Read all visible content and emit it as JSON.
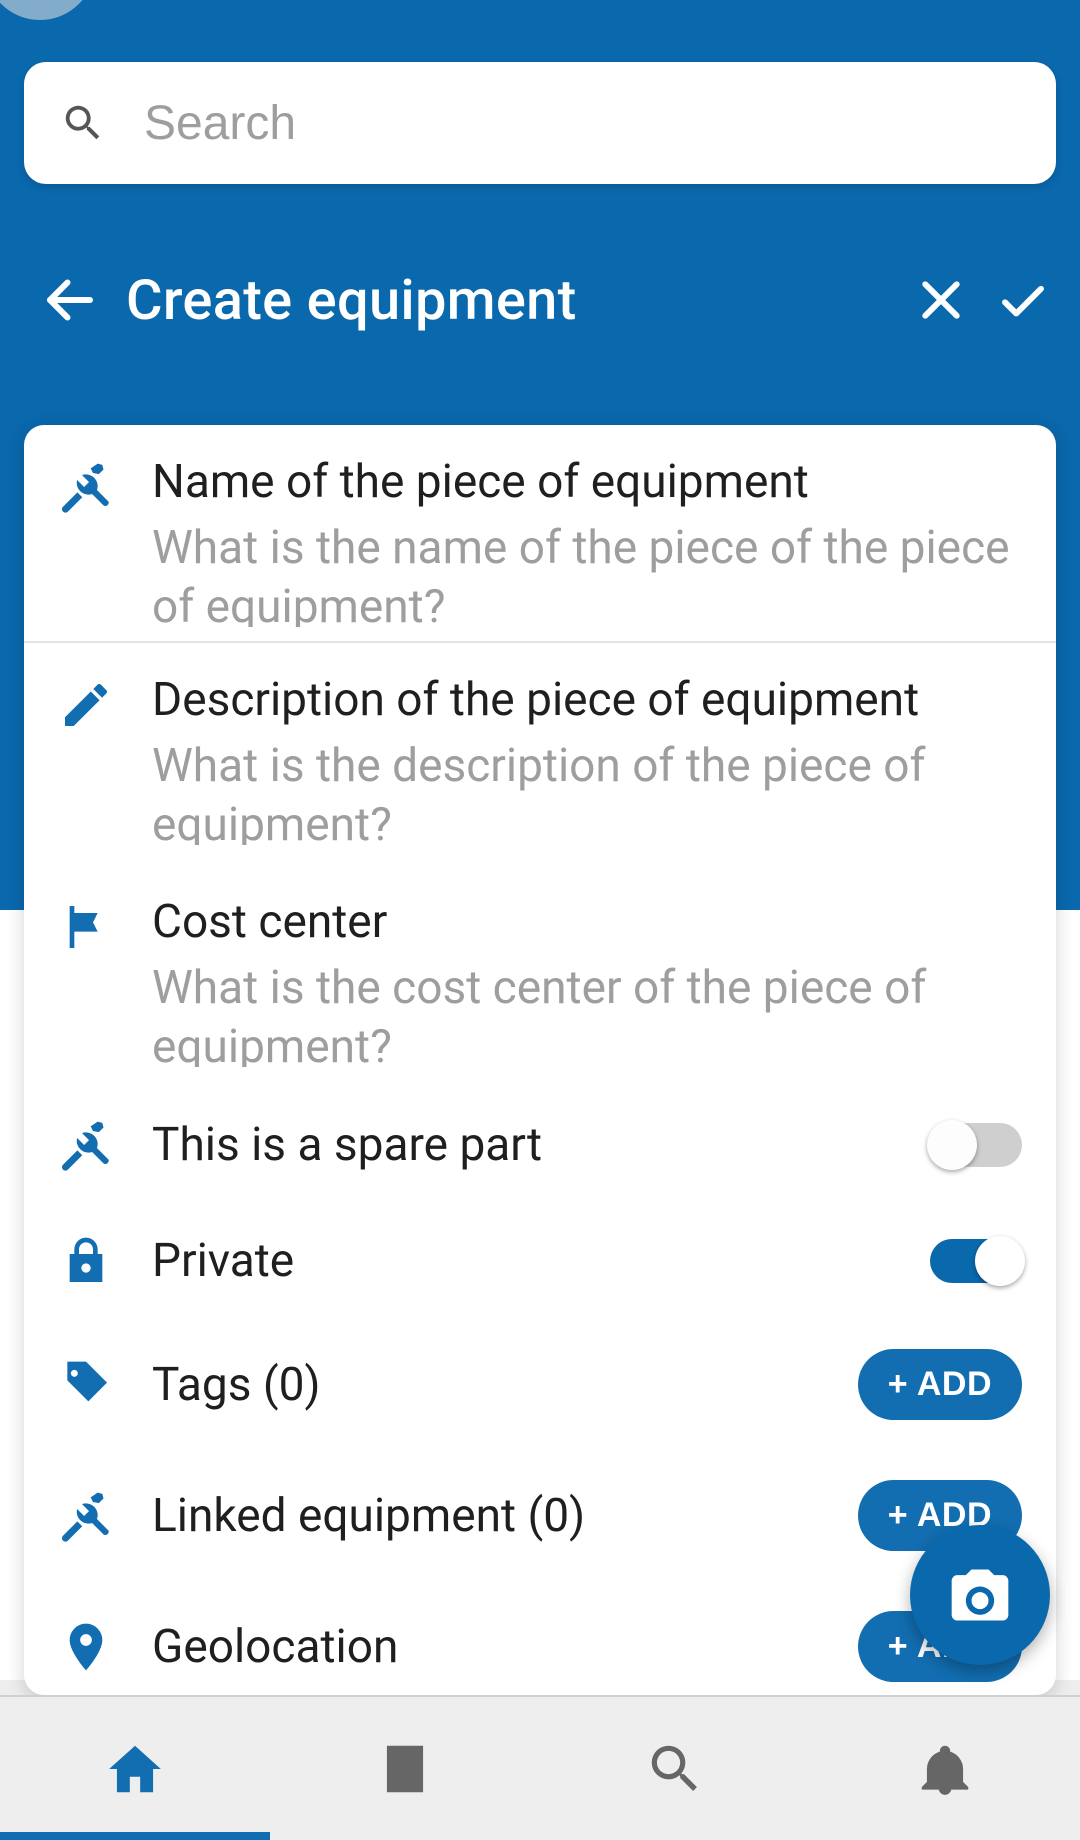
{
  "search": {
    "placeholder": "Search"
  },
  "header": {
    "title": "Create equipment"
  },
  "fields": {
    "name": {
      "label": "Name of the piece of equipment",
      "placeholder": "What is the name of the piece of the piece of equipment?"
    },
    "description": {
      "label": "Description of the piece of equipment",
      "placeholder": "What is the description of the piece of equipment?"
    },
    "cost_center": {
      "label": "Cost center",
      "placeholder": "What is the cost center of the piece of equipment?"
    }
  },
  "toggles": {
    "spare_part": {
      "label": "This is a spare part",
      "value": false
    },
    "private": {
      "label": "Private",
      "value": true
    }
  },
  "lists": {
    "tags": {
      "label": "Tags (0)",
      "count": 0,
      "button": "+ ADD"
    },
    "linked_equipment": {
      "label": "Linked equipment (0)",
      "count": 0,
      "button": "+ ADD"
    },
    "geolocation": {
      "label": "Geolocation",
      "button": "+ ADD"
    }
  },
  "colors": {
    "brand": "#0a68ad",
    "accent": "#126eb1"
  }
}
